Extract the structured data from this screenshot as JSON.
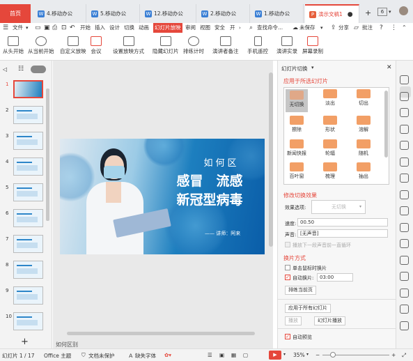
{
  "tabs": {
    "home": "首页",
    "docs": [
      {
        "label": "4.移动办公",
        "icon": "W"
      },
      {
        "label": "5.移动办公",
        "icon": "W"
      },
      {
        "label": "12.移动办公",
        "icon": "W"
      },
      {
        "label": "2.移动办公",
        "icon": "W"
      },
      {
        "label": "1.移动办公",
        "icon": "W"
      },
      {
        "label": "演示文稿1",
        "icon": "P"
      }
    ],
    "count": "6"
  },
  "menu": {
    "file": "文件",
    "start": "开始",
    "insert": "插入",
    "design": "设计",
    "transition": "切换",
    "animation": "动画",
    "slideshow": "幻灯片放映",
    "review": "审阅",
    "view": "视图",
    "security": "安全",
    "dev": "开",
    "search": "查找命令...",
    "unsaved": "未保存",
    "share": "分享",
    "annotate": "批注"
  },
  "ribbon": {
    "from_start": "从头开始",
    "from_current": "从当前开始",
    "custom": "自定义放映",
    "meeting": "会议",
    "setup": "设置放映方式",
    "hide": "隐藏幻灯片",
    "rehearse": "排练计时",
    "notes": "演讲者备注",
    "remote": "手机遥控",
    "record": "演讲实录",
    "screen_rec": "屏幕录制"
  },
  "slide": {
    "area": "如何区",
    "title1": "感冒　流感",
    "title2": "新冠型病毒",
    "speaker": "—— 讲师：阿来"
  },
  "panel": {
    "header": "幻灯片切换",
    "apply_selected": "应用于所选幻灯片",
    "transitions": [
      "无切换",
      "淡出",
      "切出",
      "擦除",
      "形状",
      "溶解",
      "新闻快报",
      "轮辐",
      "随机",
      "百叶窗",
      "梳理",
      "抽出"
    ],
    "modify": "修改切换效果",
    "effect_label": "效果选项:",
    "effect_value": "无切换",
    "speed_label": "速度:",
    "speed_value": "00.50",
    "sound_label": "声音:",
    "sound_value": "[无声音]",
    "loop": "播放下一段声音前一直循环",
    "advance": "换片方式",
    "on_click": "单击鼠标时换片",
    "auto": "自动换片:",
    "auto_value": "03:00",
    "rehearse_current": "排练当前页",
    "apply_all": "应用于所有幻灯片",
    "play": "播放",
    "show": "幻灯片播放",
    "autopreview": "自动预览"
  },
  "status": {
    "slide": "幻灯片 1 / 17",
    "theme": "Office 主题",
    "protect": "文档未保护",
    "font": "缺失字体",
    "zoom": "35%",
    "notes_hint": "如何区别"
  },
  "slide_numbers": [
    "1",
    "2",
    "3",
    "4",
    "5",
    "6",
    "7",
    "8",
    "9",
    "10"
  ]
}
